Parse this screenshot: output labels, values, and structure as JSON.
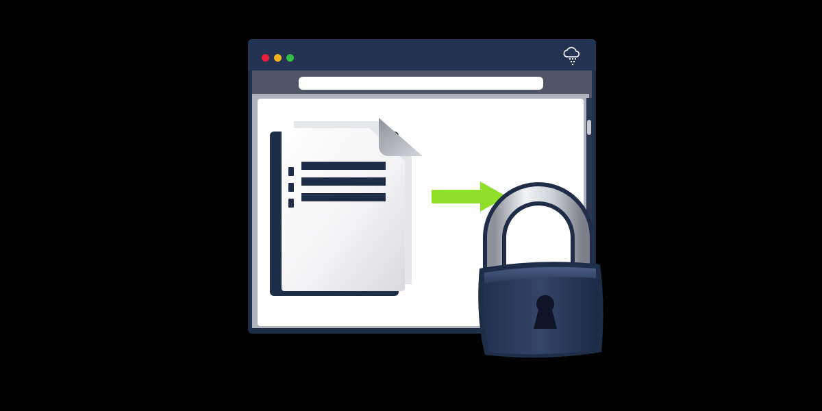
{
  "window": {
    "controls": [
      {
        "name": "close-dot",
        "color": "#e8203a"
      },
      {
        "name": "minimize-dot",
        "color": "#f2b21c"
      },
      {
        "name": "maximize-dot",
        "color": "#2fbf44"
      }
    ],
    "corner_icon": "cloud-data-icon"
  },
  "illustration": {
    "document_icon": "document-icon",
    "arrow_icon": "arrow-right-icon",
    "lock_icon": "padlock-icon",
    "colors": {
      "frame": "#1f2d48",
      "arrow": "#8fdf2b",
      "lock_body": "#2b3a5c",
      "shackle": "#c9ccd2"
    }
  }
}
